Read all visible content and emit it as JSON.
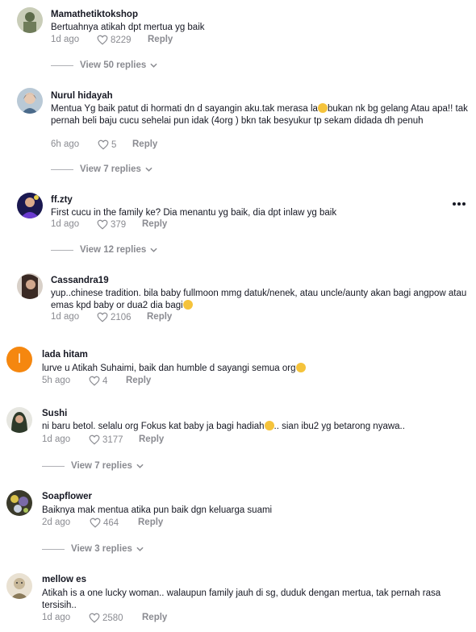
{
  "comments": [
    {
      "username": "Mamathetiktokshop",
      "text": "Bertuahnya atikah dpt mertua yg baik",
      "time": "1d ago",
      "likes": "8229",
      "reply": "Reply",
      "view_replies": "View 50 replies",
      "avatar_color": "#6f7c5a"
    },
    {
      "username": "Nurul hidayah",
      "text_a": "Mentua Yg baik patut di hormati dn d sayangin aku.tak merasa la",
      "text_b": "bukan nk bg gelang Atau apa!! tak pernah beli baju cucu sehelai pun idak (4org ) bkn tak besyukur tp sekam didada dh penuh",
      "time": "6h ago",
      "likes": "5",
      "reply": "Reply",
      "view_replies": "View 7 replies",
      "avatar_color": "#4a6a8a"
    },
    {
      "username": "ff.zty",
      "text": "First cucu in the family ke? Dia menantu yg baik, dia dpt inlaw yg baik",
      "time": "1d ago",
      "likes": "379",
      "reply": "Reply",
      "view_replies": "View 12 replies",
      "avatar_color": "#2b2a7a"
    },
    {
      "username": "Cassandra19",
      "text": "yup..chinese tradition. bila baby fullmoon mmg datuk/nenek, atau uncle/aunty akan bagi angpow atau emas kpd baby or dua2 dia bagi",
      "time": "1d ago",
      "likes": "2106",
      "reply": "Reply",
      "avatar_color": "#3a2a24"
    },
    {
      "username": "lada hitam",
      "text": "lurve u Atikah Suhaimi, baik dan humble d sayangi semua org",
      "time": "5h ago",
      "likes": "4",
      "reply": "Reply",
      "avatar_letter": "l",
      "avatar_color": "#f5870f"
    },
    {
      "username": "Sushi",
      "text_a": "ni baru betol. selalu org Fokus kat baby ja bagi hadiah",
      "text_b": ".. sian ibu2 yg betarong nyawa..",
      "time": "1d ago",
      "likes": "3177",
      "reply": "Reply",
      "view_replies": "View 7 replies",
      "avatar_color": "#2d3a2a"
    },
    {
      "username": "Soapflower",
      "text": "Baiknya mak mentua atika pun baik dgn keluarga suami",
      "time": "2d ago",
      "likes": "464",
      "reply": "Reply",
      "view_replies": "View 3 replies",
      "avatar_color": "#6a5a8a"
    },
    {
      "username": "mellow es",
      "text": "Atikah is a one lucky woman.. walaupun family jauh di sg, duduk dengan mertua, tak pernah rasa tersisih..",
      "time": "1d ago",
      "likes": "2580",
      "reply": "Reply",
      "avatar_color": "#c8b89a"
    }
  ],
  "more_icon": "more-horizontal-icon",
  "colors": {
    "muted": "#8a8b91",
    "text": "#161823",
    "orange_avatar": "#f5870f"
  }
}
